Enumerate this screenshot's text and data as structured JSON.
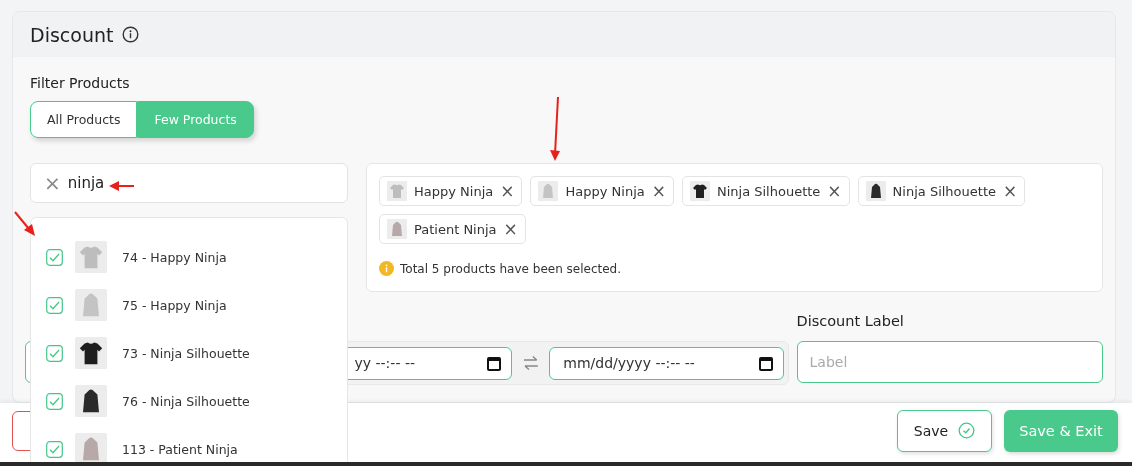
{
  "card": {
    "title": "Discount"
  },
  "filter": {
    "label": "Filter Products",
    "options": [
      {
        "label": "All Products",
        "selected": false
      },
      {
        "label": "Few Products",
        "selected": true
      }
    ]
  },
  "search": {
    "value": "ninja",
    "clear": "×"
  },
  "results": [
    {
      "label": "74 - Happy Ninja",
      "checked": true,
      "kind": "tshirt",
      "color": "#bdbdbd"
    },
    {
      "label": "75 - Happy Ninja",
      "checked": true,
      "kind": "hoodie",
      "color": "#c4c4c4"
    },
    {
      "label": "73 - Ninja Silhouette",
      "checked": true,
      "kind": "tshirt",
      "color": "#1f1f1f"
    },
    {
      "label": "76 - Ninja Silhouette",
      "checked": true,
      "kind": "hoodie",
      "color": "#2a2a2a"
    },
    {
      "label": "113 - Patient Ninja",
      "checked": true,
      "kind": "hoodie",
      "color": "#b8a9a9"
    }
  ],
  "selected_tags": [
    {
      "label": "Happy Ninja",
      "remove": "×",
      "kind": "tshirt",
      "color": "#bdbdbd"
    },
    {
      "label": "Happy Ninja",
      "remove": "×",
      "kind": "hoodie",
      "color": "#c4c4c4"
    },
    {
      "label": "Ninja Silhouette",
      "remove": "×",
      "kind": "tshirt",
      "color": "#1f1f1f"
    },
    {
      "label": "Ninja Silhouette",
      "remove": "×",
      "kind": "hoodie",
      "color": "#2a2a2a"
    },
    {
      "label": "Patient Ninja",
      "remove": "×",
      "kind": "hoodie",
      "color": "#b8a9a9"
    }
  ],
  "selection_note": "Total 5 products have been selected.",
  "fields": {
    "start_date": "yy --:-- --",
    "end_date": "mm/dd/yyyy --:-- --",
    "discount_label": {
      "label": "Discount Label",
      "placeholder": "Label"
    }
  },
  "footer": {
    "save": "Save",
    "save_exit": "Save & Exit"
  }
}
